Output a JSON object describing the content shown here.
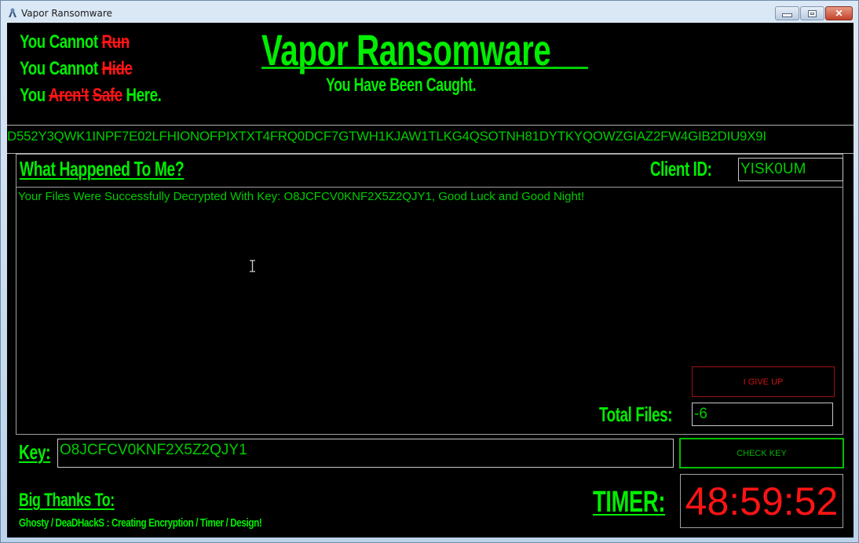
{
  "window": {
    "title": "Vapor Ransomware",
    "controls": {
      "minimize": "minimize",
      "maximize": "maximize",
      "close": "✕"
    }
  },
  "header": {
    "slogans": [
      {
        "prefix": "You Cannot ",
        "red": [
          "Run"
        ],
        "suffix": ""
      },
      {
        "prefix": "You Cannot ",
        "red": [
          "Hide"
        ],
        "suffix": ""
      },
      {
        "prefix": "You ",
        "red": [
          "Aren't",
          "Safe"
        ],
        "suffix": " Here."
      }
    ],
    "title": "Vapor Ransomware",
    "subtitle": "You Have Been Caught."
  },
  "hash_string": "D552Y3QWK1INPF7E02LFHIONOFPIXTXT4FRQ0DCF7GTWH1KJAW1TLKG4QSOTNH81DYTKYQOWZGIAZ2FW4GIB2DIU9X9I",
  "panel": {
    "heading": "What Happened To Me?",
    "client_id_label": "Client ID:",
    "client_id_value": "YISK0UM",
    "message": "Your Files Were Successfully Decrypted With Key: O8JCFCV0KNF2X5Z2QJY1, Good Luck and Good Night!",
    "give_up_label": "I GIVE UP",
    "total_files_label": "Total Files:",
    "total_files_value": "-6"
  },
  "key": {
    "label": "Key:",
    "value": "O8JCFCV0KNF2X5Z2QJY1",
    "check_label": "CHECK KEY"
  },
  "timer": {
    "label": "TIMER:",
    "value": "48:59:52"
  },
  "credits": {
    "heading": "Big Thanks To:",
    "line": "Ghosty / DeaDHackS : Creating Encryption / Timer / Design!"
  },
  "colors": {
    "accent_green": "#00ee00",
    "alert_red": "#ff1414",
    "background": "#000000"
  }
}
